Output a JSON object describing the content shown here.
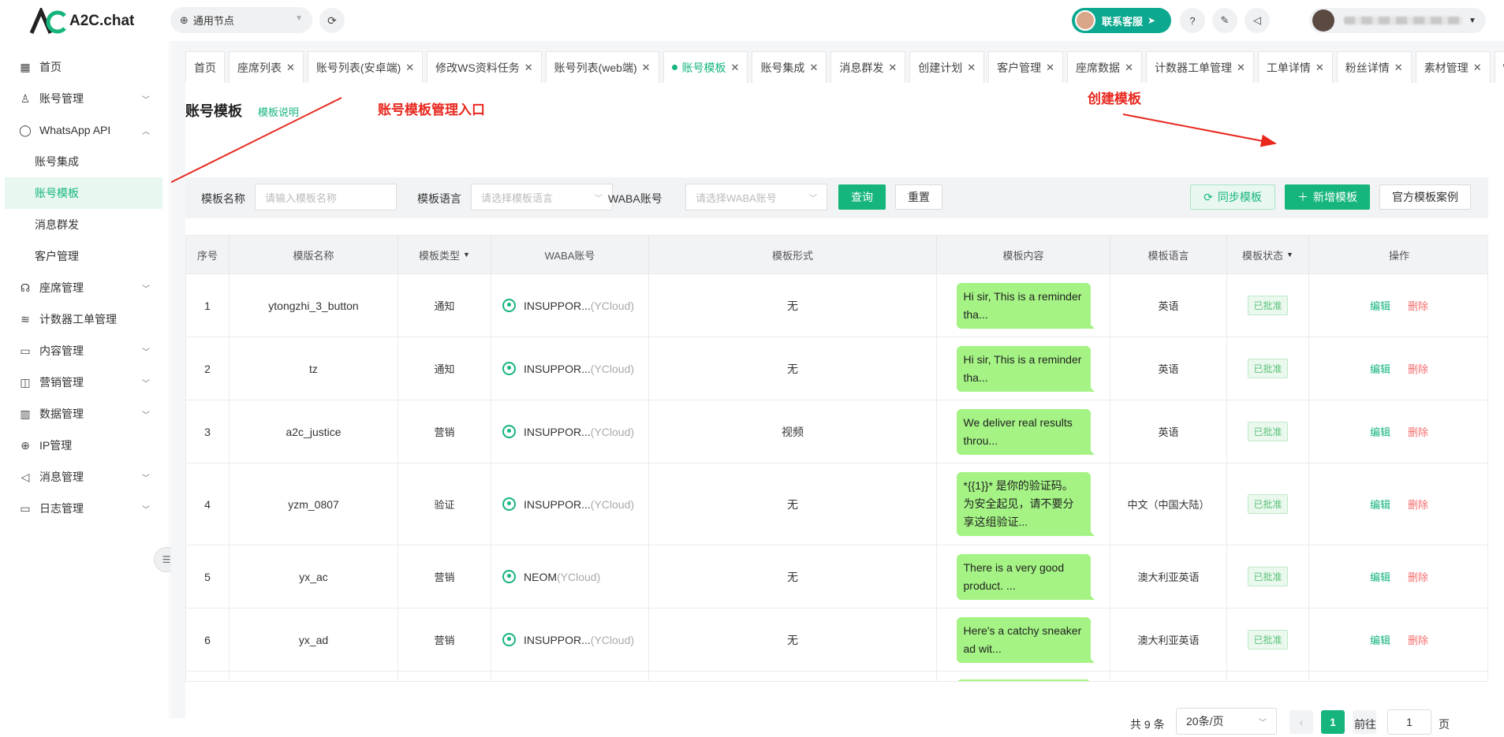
{
  "brand": {
    "name": "A2C.chat",
    "accent": "#16b57c"
  },
  "header": {
    "node": "通用节点",
    "contact": "联系客服",
    "icons": [
      "refresh-icon",
      "help-icon",
      "notes-icon",
      "megaphone-icon"
    ]
  },
  "sidebar": {
    "items": [
      {
        "label": "首页",
        "icon": "grid-icon"
      },
      {
        "label": "账号管理",
        "icon": "user-icon"
      },
      {
        "label": "WhatsApp API",
        "icon": "whatsapp-icon"
      },
      {
        "label": "座席管理",
        "icon": "agent-icon"
      },
      {
        "label": "计数器工单管理",
        "icon": "layers-icon"
      },
      {
        "label": "内容管理",
        "icon": "folder-icon"
      },
      {
        "label": "营销管理",
        "icon": "chart-icon"
      },
      {
        "label": "数据管理",
        "icon": "bar-icon"
      },
      {
        "label": "IP管理",
        "icon": "globe-icon"
      },
      {
        "label": "消息管理",
        "icon": "megaphone-icon"
      },
      {
        "label": "日志管理",
        "icon": "monitor-icon"
      }
    ],
    "sub_items": [
      "账号集成",
      "账号模板",
      "消息群发",
      "客户管理"
    ]
  },
  "tabs": [
    "首页",
    "座席列表",
    "账号列表(安卓端)",
    "修改WS资料任务",
    "账号列表(web端)",
    "账号模板",
    "账号集成",
    "消息群发",
    "创建计划",
    "客户管理",
    "座席数据",
    "计数器工单管理",
    "工单详情",
    "粉丝详情",
    "素材管理",
    "WS"
  ],
  "page": {
    "title": "账号模板",
    "help_link": "模板说明",
    "annotation_entry": "账号模板管理入口",
    "annotation_create": "创建模板"
  },
  "filters": {
    "name_label": "模板名称",
    "name_placeholder": "请输入模板名称",
    "lang_label": "模板语言",
    "lang_placeholder": "请选择模板语言",
    "waba_label": "WABA账号",
    "waba_placeholder": "请选择WABA账号",
    "query": "查询",
    "reset": "重置",
    "sync": "同步模板",
    "add": "新增模板",
    "examples": "官方模板案例"
  },
  "table": {
    "headers": [
      "序号",
      "模版名称",
      "模板类型",
      "WABA账号",
      "模板形式",
      "模板内容",
      "模板语言",
      "模板状态",
      "操作"
    ],
    "rows": [
      {
        "no": "1",
        "name": "ytongzhi_3_button",
        "type": "通知",
        "waba": "INSUPPOR...",
        "src": "(YCloud)",
        "form": "无",
        "content": "Hi sir, This is a reminder tha...",
        "lang": "英语",
        "status": "已批准"
      },
      {
        "no": "2",
        "name": "tz",
        "type": "通知",
        "waba": "INSUPPOR...",
        "src": "(YCloud)",
        "form": "无",
        "content": "Hi sir, This is a reminder tha...",
        "lang": "英语",
        "status": "已批准"
      },
      {
        "no": "3",
        "name": "a2c_justice",
        "type": "营销",
        "waba": "INSUPPOR...",
        "src": "(YCloud)",
        "form": "视频",
        "content": " We deliver real results throu...",
        "lang": "英语",
        "status": "已批准"
      },
      {
        "no": "4",
        "name": "yzm_0807",
        "type": "验证",
        "waba": "INSUPPOR...",
        "src": "(YCloud)",
        "form": "无",
        "content": "*{{1}}* 是你的验证码。为安全起见，请不要分享这组验证...",
        "lang": "中文（中国大陆）",
        "status": "已批准"
      },
      {
        "no": "5",
        "name": "yx_ac",
        "type": "营销",
        "waba": "NEOM",
        "src": "(YCloud)",
        "form": "无",
        "content": "There is a very good product. ...",
        "lang": "澳大利亚英语",
        "status": "已批准"
      },
      {
        "no": "6",
        "name": "yx_ad",
        "type": "营销",
        "waba": "INSUPPOR...",
        "src": "(YCloud)",
        "form": "无",
        "content": "Here's a catchy sneaker ad wit...",
        "lang": "澳大利亚英语",
        "status": "已批准"
      }
    ],
    "edit": "编辑",
    "delete": "删除"
  },
  "pagination": {
    "total": "共 9 条",
    "page_size": "20条/页",
    "current": "1",
    "goto_label": "前往",
    "goto_value": "1",
    "page_suffix": "页"
  }
}
